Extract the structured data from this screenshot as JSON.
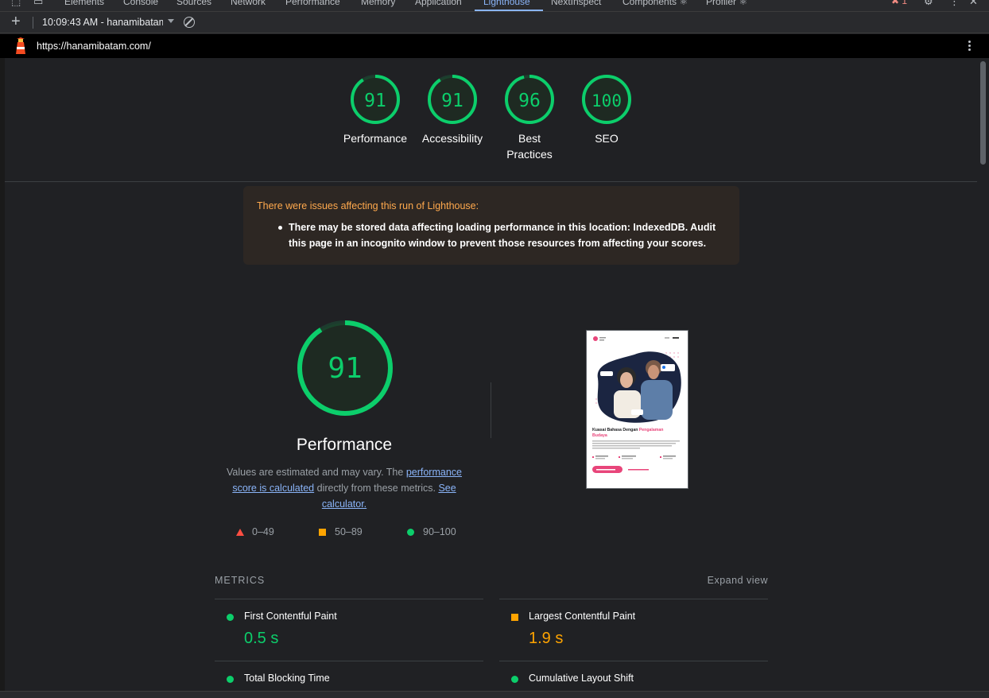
{
  "devtools_tabs": [
    "Elements",
    "Console",
    "Sources",
    "Network",
    "Performance",
    "Memory",
    "Application",
    "Lighthouse",
    "NextInspect",
    "Components ⚛",
    "Profiler ⚛"
  ],
  "active_tab": "Lighthouse",
  "error_count": "1",
  "run_selector": "10:09:43 AM - hanamibatam.com",
  "url": "https://hanamibatam.com/",
  "categories": [
    {
      "score": "91",
      "label": "Performance",
      "value": 91
    },
    {
      "score": "91",
      "label": "Accessibility",
      "value": 91
    },
    {
      "score": "96",
      "label": "Best Practices",
      "value": 96
    },
    {
      "score": "100",
      "label": "SEO",
      "value": 100
    }
  ],
  "warning": {
    "title": "There were issues affecting this run of Lighthouse:",
    "item": "There may be stored data affecting loading performance in this location: IndexedDB. Audit this page in an incognito window to prevent those resources from affecting your scores."
  },
  "performance": {
    "score": "91",
    "value": 91,
    "title": "Performance",
    "desc_prefix": "Values are estimated and may vary. The ",
    "desc_link1": "performance score is calculated",
    "desc_middle": " directly from these metrics. ",
    "desc_link2": "See calculator."
  },
  "legend": [
    {
      "range": "0–49",
      "color": "#ff4e42"
    },
    {
      "range": "50–89",
      "color": "#ffa400"
    },
    {
      "range": "90–100",
      "color": "#0cce6b"
    }
  ],
  "screenshot_page": {
    "heading_part1": "Kuasai Bahasa Dengan ",
    "heading_highlight": "Pengalaman",
    "heading_part2": "Budaya"
  },
  "metrics": {
    "header": "METRICS",
    "expand": "Expand view",
    "items": [
      {
        "name": "First Contentful Paint",
        "value": "0.5 s",
        "color": "#0cce6b"
      },
      {
        "name": "Largest Contentful Paint",
        "value": "1.9 s",
        "color": "#ffa400"
      },
      {
        "name": "Total Blocking Time",
        "value": "",
        "color": "#0cce6b"
      },
      {
        "name": "Cumulative Layout Shift",
        "value": "",
        "color": "#0cce6b"
      }
    ]
  },
  "colors": {
    "pass": "#0cce6b",
    "average": "#ffa400",
    "fail": "#ff4e42",
    "link": "#8ab4f8"
  }
}
